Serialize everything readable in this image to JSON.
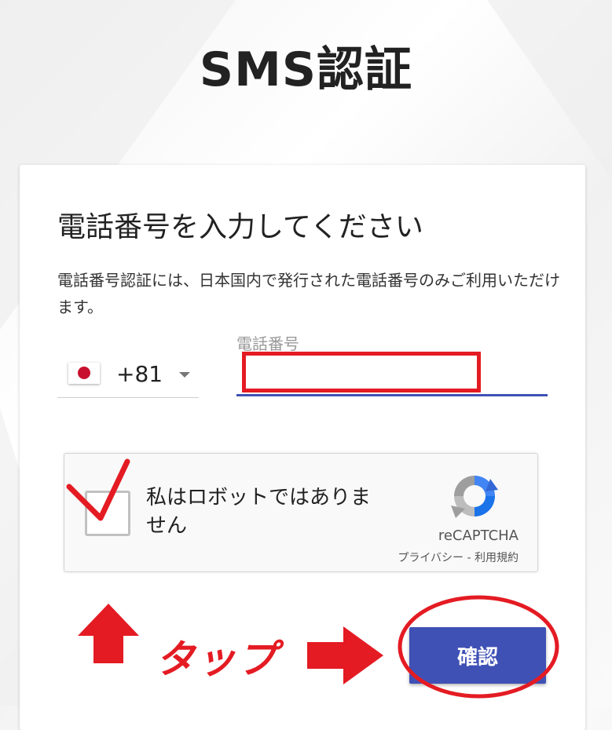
{
  "page": {
    "title": "SMS認証"
  },
  "card": {
    "heading": "電話番号を入力してください",
    "description": "電話番号認証には、日本国内で発行された電話番号のみご利用いただけます。"
  },
  "phone": {
    "country_code": "+81",
    "country_flag": "japan-flag-icon",
    "label": "電話番号",
    "value": ""
  },
  "recaptcha": {
    "checkbox_label": "私はロボットではありません",
    "brand": "reCAPTCHA",
    "links": "プライバシー - 利用規約"
  },
  "confirm_button": {
    "label": "確認"
  },
  "annotation": {
    "tap_label": "タップ",
    "color": "#e41b23"
  },
  "colors": {
    "accent": "#3f51b5",
    "flag_red": "#c8102e"
  }
}
